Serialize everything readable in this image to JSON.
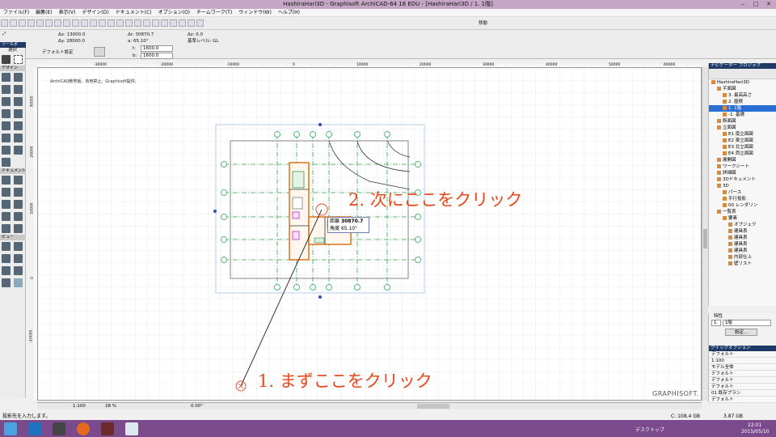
{
  "window": {
    "title": "HashiraHari3D - Graphisoft ArchiCAD-64 18 EDU - [HashiraHari3D / 1. 1階]"
  },
  "menu": [
    "ファイル(F)",
    "編集(E)",
    "表示(V)",
    "デザイン(D)",
    "ドキュメント(C)",
    "オプション(O)",
    "チームワーク(T)",
    "ウィンドウ(W)",
    "ヘルプ(H)"
  ],
  "toolbar": {
    "move_label": "移動"
  },
  "infobox": {
    "dx": "Δx: 13000.0",
    "dy": "Δy: 28000.0",
    "dr": "Δr: 30870.7",
    "angle": "a: 65.10°",
    "dz": "Δz: 0.0",
    "ref_level": "基準レベル: GL",
    "default_label": "デフォルト設定",
    "t_label": "t:",
    "t_value": "1600.0",
    "b_label": "b:",
    "b_value": "1600.0"
  },
  "toolbox": {
    "title": "ツールボ",
    "select_label": "選択",
    "design_label": "デザイン",
    "document_label": "ドキュメント",
    "view_label": "ビュー"
  },
  "canvas": {
    "caption": "ArchiCAD教育版。商用禁止。Graphisoft提供。",
    "watermark": "GRAPHISOFT.",
    "ruler_labels": [
      "-30000",
      "-20000",
      "-10000",
      "0",
      "10000",
      "20000",
      "30000",
      "40000",
      "50000",
      "60000"
    ],
    "ruler_left_labels": [
      "30000",
      "20000",
      "10000",
      "0",
      "-10000"
    ],
    "tracker": {
      "dist_label": "距離",
      "dist_value": "30870.7",
      "angle_label": "角度",
      "angle_value": "65.10°"
    }
  },
  "annotations": {
    "first_click": "1. まずここをクリック",
    "second_click": "2. 次にここをクリック"
  },
  "statusbar": {
    "scale": "1:100",
    "zoom": "28 %",
    "angle": "0.00°",
    "cmd": "S"
  },
  "navigator": {
    "title": "ナビゲーター プロジェク",
    "items": [
      {
        "label": "HashiraHari3D",
        "indent": 0
      },
      {
        "label": "平面図",
        "indent": 1
      },
      {
        "label": "3. 最高高さ",
        "indent": 2
      },
      {
        "label": "2. 屋根",
        "indent": 2
      },
      {
        "label": "1. 1階",
        "indent": 2,
        "selected": true
      },
      {
        "label": "-1. 基礎",
        "indent": 2
      },
      {
        "label": "断面図",
        "indent": 1
      },
      {
        "label": "立面図",
        "indent": 1
      },
      {
        "label": "E1 南立面図",
        "indent": 2
      },
      {
        "label": "E2 東立面図",
        "indent": 2
      },
      {
        "label": "E3 北立面図",
        "indent": 2
      },
      {
        "label": "E4 西立面図",
        "indent": 2
      },
      {
        "label": "展開図",
        "indent": 1
      },
      {
        "label": "ワークシート",
        "indent": 1
      },
      {
        "label": "詳細図",
        "indent": 1
      },
      {
        "label": "3Dドキュメント",
        "indent": 1
      },
      {
        "label": "3D",
        "indent": 1
      },
      {
        "label": "パース",
        "indent": 2
      },
      {
        "label": "平行投影",
        "indent": 2
      },
      {
        "label": "00 レンダリン",
        "indent": 2
      },
      {
        "label": "一覧表",
        "indent": 1
      },
      {
        "label": "要素",
        "indent": 2
      },
      {
        "label": "オブジェク",
        "indent": 3
      },
      {
        "label": "建具表",
        "indent": 3
      },
      {
        "label": "建具表",
        "indent": 3
      },
      {
        "label": "建具表",
        "indent": 3
      },
      {
        "label": "建具表",
        "indent": 3
      },
      {
        "label": "内部仕上",
        "indent": 3
      },
      {
        "label": "壁リスト",
        "indent": 3
      }
    ]
  },
  "props": {
    "header": "特性",
    "num": "1.",
    "name": "1階",
    "settings_btn": "設定..."
  },
  "quick": {
    "title": "クイックオプション",
    "rows": [
      "デフォルト",
      "1:100",
      "モデル全体",
      "デフォルト",
      "デフォルト",
      "デフォルト",
      "01 既存プラン",
      "デフォルト"
    ]
  },
  "hint": "投影先を入力します。",
  "taskbar": {
    "desktop": "デスクトップ",
    "disk": "C: 108.4 GB",
    "mem": "3.87 GB",
    "time": "22:01",
    "date": "2015/05/10"
  }
}
